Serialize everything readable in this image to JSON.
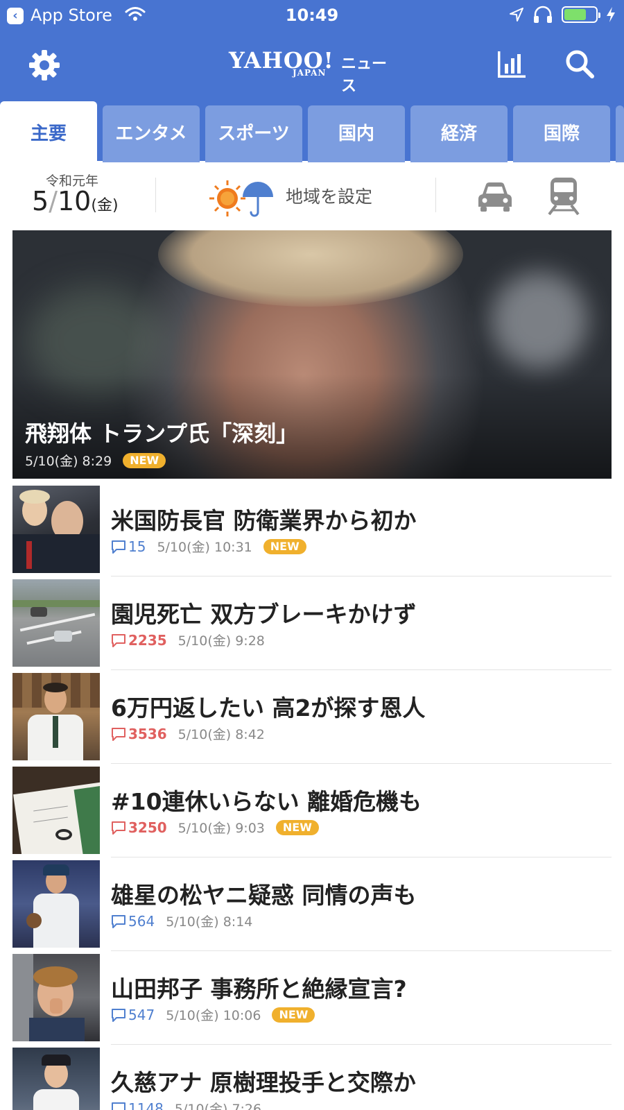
{
  "status_bar": {
    "back_label": "App Store",
    "time": "10:49"
  },
  "header": {
    "logo_main": "YAHOO!",
    "logo_sub": "JAPAN",
    "logo_service": "ニュース",
    "icons": [
      "gear-icon",
      "ranking-icon",
      "search-icon"
    ],
    "bg_color": "#4874d1"
  },
  "tabs": [
    {
      "label": "主要",
      "active": true
    },
    {
      "label": "エンタメ",
      "active": false
    },
    {
      "label": "スポーツ",
      "active": false
    },
    {
      "label": "国内",
      "active": false
    },
    {
      "label": "経済",
      "active": false
    },
    {
      "label": "国際",
      "active": false
    }
  ],
  "info": {
    "era": "令和元年",
    "month": "5",
    "day": "10",
    "weekday": "(金)",
    "region_label": "地域を設定",
    "icons": [
      "sun-icon",
      "umbrella-icon",
      "car-icon",
      "train-icon"
    ]
  },
  "hero": {
    "title": "飛翔体 トランプ氏「深刻」",
    "time": "5/10(金) 8:29",
    "badge": "NEW"
  },
  "articles": [
    {
      "title": "米国防長官 防衛業界から初か",
      "comments": "15",
      "comment_style": "blue",
      "time": "5/10(金) 10:31",
      "badge": "NEW"
    },
    {
      "title": "園児死亡 双方ブレーキかけず",
      "comments": "2235",
      "comment_style": "red",
      "time": "5/10(金) 9:28",
      "badge": ""
    },
    {
      "title": "6万円返したい 高2が探す恩人",
      "comments": "3536",
      "comment_style": "red",
      "time": "5/10(金) 8:42",
      "badge": ""
    },
    {
      "title": "#10連休いらない 離婚危機も",
      "comments": "3250",
      "comment_style": "red",
      "time": "5/10(金) 9:03",
      "badge": "NEW"
    },
    {
      "title": "雄星の松ヤニ疑惑 同情の声も",
      "comments": "564",
      "comment_style": "blue",
      "time": "5/10(金) 8:14",
      "badge": ""
    },
    {
      "title": "山田邦子 事務所と絶縁宣言?",
      "comments": "547",
      "comment_style": "blue",
      "time": "5/10(金) 10:06",
      "badge": "NEW"
    },
    {
      "title": "久慈アナ 原樹理投手と交際か",
      "comments": "1148",
      "comment_style": "blue",
      "time": "5/10(金) 7:26",
      "badge": ""
    }
  ]
}
